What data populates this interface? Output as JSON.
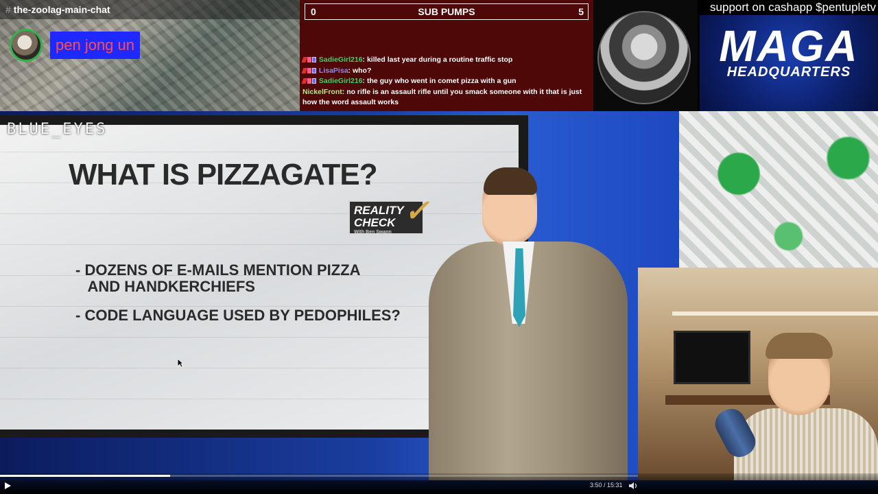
{
  "discord": {
    "channel": "the-zoolag-main-chat",
    "hash": "#",
    "username": "pen jong un"
  },
  "chat": {
    "sub_counter": {
      "left": "0",
      "title": "SUB PUMPS",
      "right": "5"
    },
    "messages": [
      {
        "user": "SadieGirl216",
        "text": "killed last year during a routine traffic stop"
      },
      {
        "user": "LisaPisa",
        "text": "who?"
      },
      {
        "user": "SadieGirl216",
        "text": "the guy who went in comet pizza with a gun"
      },
      {
        "user": "NickelFront",
        "text": "no rifle is an assault rifle until you smack someone with it that is just how the word assault works"
      }
    ]
  },
  "cashapp": "support on cashapp $pentupletv",
  "maga": {
    "big": "MAGA",
    "small": "HEADQUARTERS"
  },
  "overlay_label": "BLUE_EYES",
  "slide": {
    "title": "WHAT IS PIZZAGATE?",
    "badge": {
      "line1": "REALITY",
      "line2": "CHECK",
      "sub": "With Ben Swann"
    },
    "bullets": [
      "- DOZENS OF E-MAILS MENTION PIZZA\n   AND HANDKERCHIEFS",
      "- CODE LANGUAGE USED BY PEDOPHILES?"
    ]
  },
  "player": {
    "time": "3:50 / 15:31",
    "progress_fraction": 0.267
  },
  "icons": [
    "play-icon",
    "volume-icon",
    "cursor-icon"
  ],
  "colors": {
    "chat_bg": "#4e0808",
    "username_bg": "#1f29ff",
    "username_text": "#ff4d4d"
  }
}
